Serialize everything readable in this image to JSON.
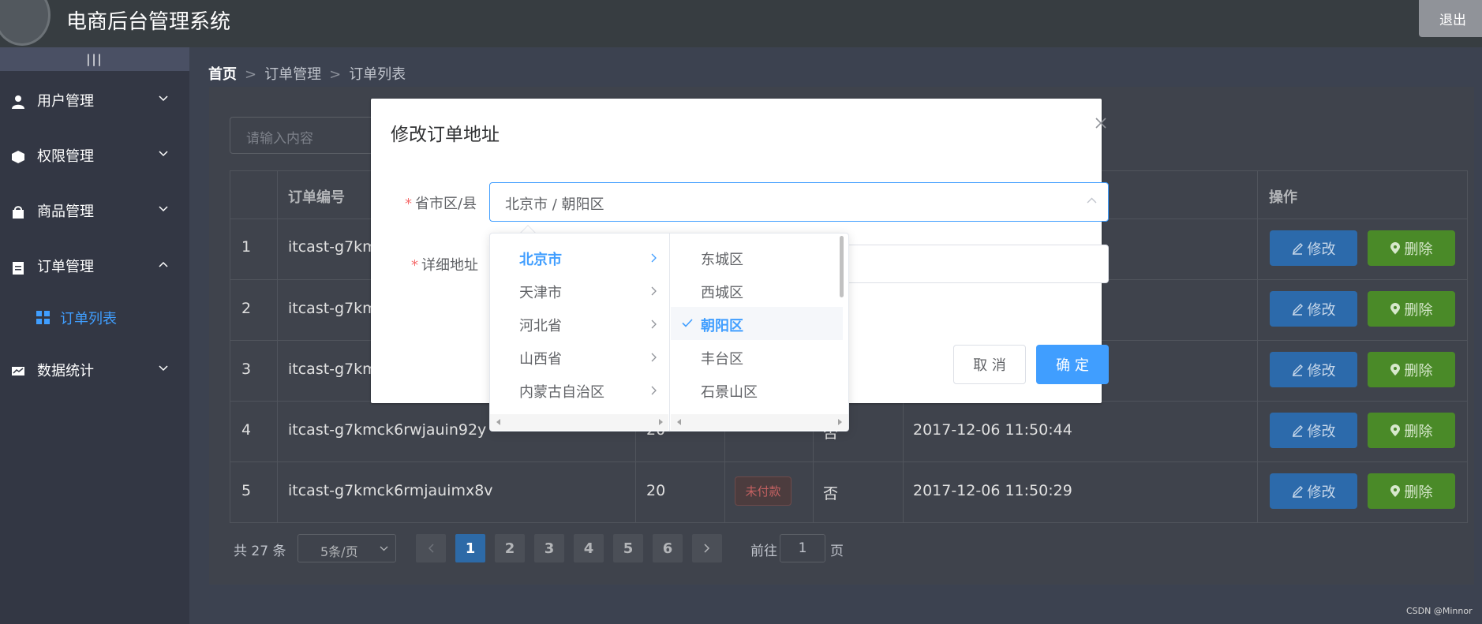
{
  "app": {
    "title": "电商后台管理系统",
    "logout_label": "退出"
  },
  "sidebar": {
    "toggle_label": "|||",
    "items": [
      {
        "label": "用户管理",
        "icon": "user-icon"
      },
      {
        "label": "权限管理",
        "icon": "box-icon"
      },
      {
        "label": "商品管理",
        "icon": "bag-icon"
      },
      {
        "label": "订单管理",
        "icon": "clipboard-icon"
      },
      {
        "label": "数据统计",
        "icon": "chart-icon"
      }
    ],
    "sub_item": {
      "label": "订单列表",
      "icon": "grid-icon"
    }
  },
  "breadcrumb": [
    "首页",
    "订单管理",
    "订单列表"
  ],
  "search": {
    "placeholder": "请输入内容"
  },
  "table": {
    "headers": [
      "订单编号",
      "操作"
    ],
    "rows": [
      {
        "index": "1",
        "order_no": "itcast-g7kmc"
      },
      {
        "index": "2",
        "order_no": "itcast-g7kmc"
      },
      {
        "index": "3",
        "order_no": "itcast-g7kmc"
      },
      {
        "index": "4",
        "order_no": "itcast-g7kmck6rwjauin92y",
        "price": "20",
        "paid": "否",
        "time": "2017-12-06 11:50:44"
      },
      {
        "index": "5",
        "order_no": "itcast-g7kmck6rmjauimx8v",
        "price": "20",
        "status": "未付款",
        "paid": "否",
        "time": "2017-12-06 11:50:29"
      }
    ],
    "edit_label": "修改",
    "delete_label": "删除"
  },
  "pagination": {
    "total": "共 27 条",
    "page_size": "5条/页",
    "pages": [
      "1",
      "2",
      "3",
      "4",
      "5",
      "6"
    ],
    "current": "1",
    "goto_prefix": "前往",
    "goto_value": "1",
    "goto_suffix": "页"
  },
  "dialog": {
    "title": "修改订单地址",
    "region_label": "省市区/县",
    "region_value": "北京市 / 朝阳区",
    "detail_label": "详细地址",
    "cancel_label": "取 消",
    "confirm_label": "确 定"
  },
  "cascader": {
    "provinces": [
      "北京市",
      "天津市",
      "河北省",
      "山西省",
      "内蒙古自治区"
    ],
    "districts": [
      "东城区",
      "西城区",
      "朝阳区",
      "丰台区",
      "石景山区"
    ],
    "selected_province": "北京市",
    "selected_district": "朝阳区"
  },
  "watermark": "CSDN @Minnor",
  "colors": {
    "primary": "#409eff",
    "danger": "#f56c6c",
    "success": "#67c23a"
  }
}
